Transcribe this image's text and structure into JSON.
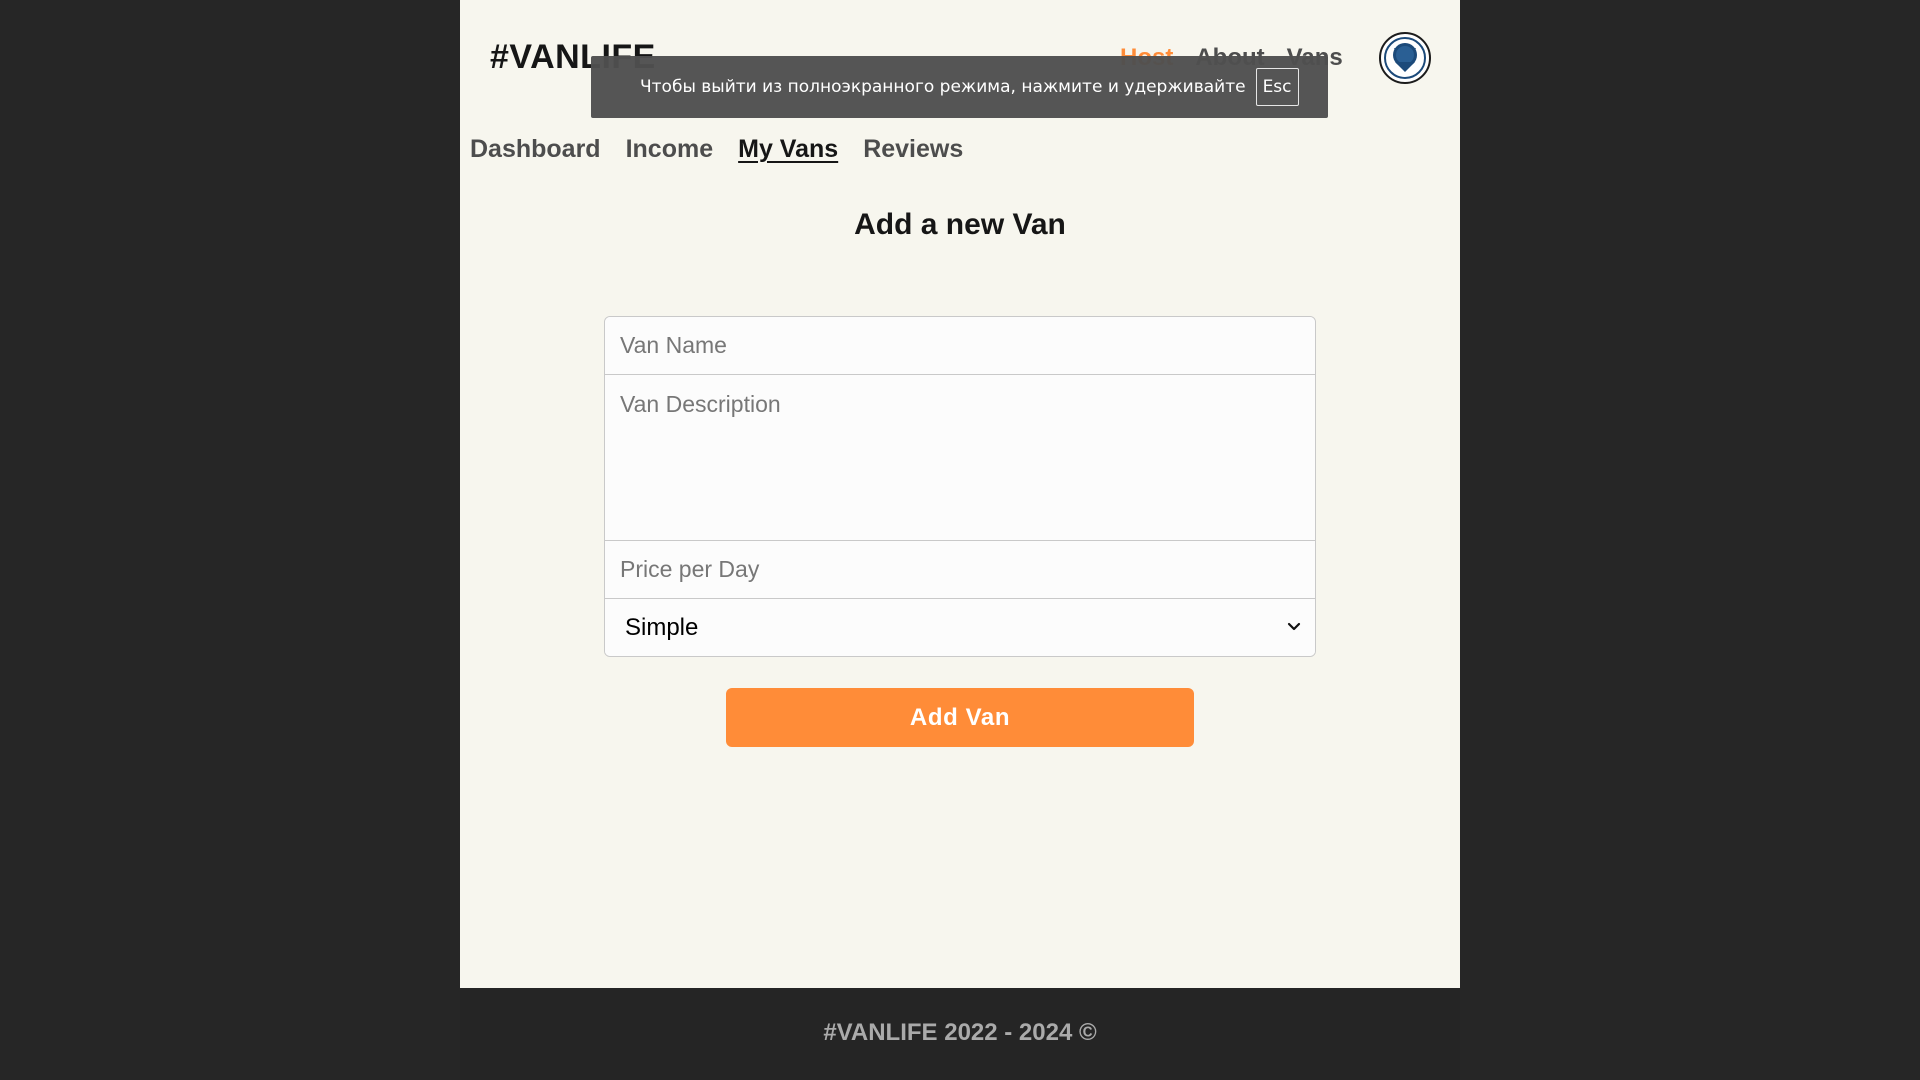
{
  "header": {
    "logo": "#VANLIFE",
    "nav": [
      {
        "label": "Host",
        "active": true
      },
      {
        "label": "About",
        "active": false
      },
      {
        "label": "Vans",
        "active": false
      }
    ],
    "avatar_icon": "user-avatar-icon"
  },
  "host_nav": [
    {
      "label": "Dashboard",
      "active": false
    },
    {
      "label": "Income",
      "active": false
    },
    {
      "label": "My Vans",
      "active": true
    },
    {
      "label": "Reviews",
      "active": false
    }
  ],
  "page": {
    "title": "Add a new Van"
  },
  "form": {
    "name_placeholder": "Van Name",
    "description_placeholder": "Van Description",
    "price_placeholder": "Price per Day",
    "type_selected": "Simple",
    "submit_label": "Add Van"
  },
  "footer": {
    "text": "#VANLIFE 2022 - 2024 ©"
  },
  "fullscreen_notice": {
    "message": "Чтобы выйти из полноэкранного режима, нажмите и удерживайте",
    "key": "Esc"
  },
  "colors": {
    "accent": "#ff8c38",
    "background": "#f7f6ee",
    "footer": "#252525",
    "text_dark": "#161616"
  }
}
